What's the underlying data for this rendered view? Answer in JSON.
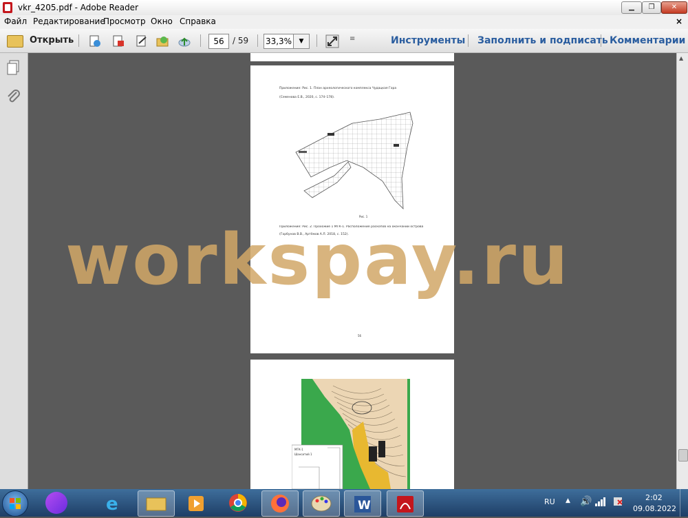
{
  "window": {
    "title": "vkr_4205.pdf - Adobe Reader"
  },
  "menu": [
    "Файл",
    "Редактирование",
    "Просмотр",
    "Окно",
    "Справка"
  ],
  "toolbar": {
    "open_label": "Открыть",
    "page_current": "56",
    "page_total": "/ 59",
    "zoom": "33,3%",
    "tools_label": "Инструменты",
    "fill_sign_label": "Заполнить и подписать",
    "comments_label": "Комментарии"
  },
  "document": {
    "caption1": "Приложение: Рис. 1. План археологического комплекса Чудацкая Гора",
    "caption1_ref": "(Семенова Е.В., 2020, с. 174–178).",
    "figure_label": "Рис. 1",
    "caption2": "Приложение: Рис. 2. Прохожие 1 МГК-1. Расположение раскопов на окончании острова",
    "caption2_ref": "(Горбунов В.В., Артёмов А.Л. 2018, с. 152).",
    "page_number": "56",
    "map_label": "МГК-1",
    "map_sublabel": "Шанситий 1"
  },
  "watermark": "workspay.ru",
  "taskbar": {
    "lang": "RU",
    "time": "2:02",
    "date": "09.08.2022"
  },
  "colors": {
    "toolbar_link": "#2a5d9f",
    "viewer_bg": "#5a5a5a",
    "map_green": "#3aa84c",
    "map_yellow": "#e8b830",
    "map_beige": "#ecd6b4",
    "watermark": "#d2a868"
  }
}
